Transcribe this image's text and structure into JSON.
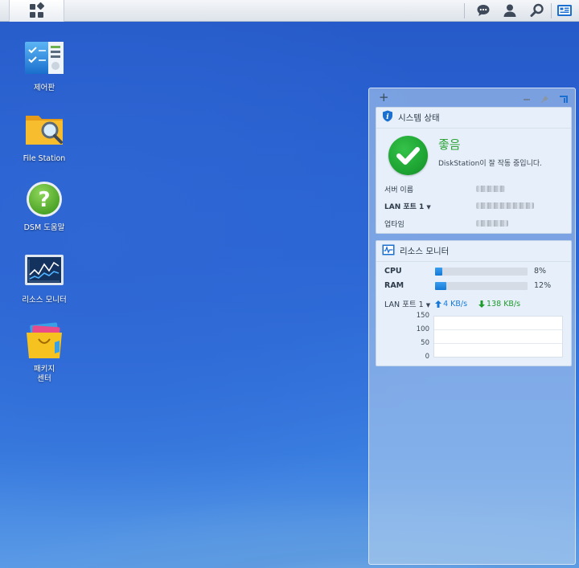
{
  "taskbar": {
    "main_menu_icon": "main-menu-grid-icon",
    "right_icons": [
      "chat-icon",
      "user-icon",
      "search-icon",
      "widgets-icon"
    ]
  },
  "desktop": {
    "icons": [
      {
        "label": "제어판",
        "icon": "control-panel-icon"
      },
      {
        "label": "File Station",
        "icon": "folder-search-icon"
      },
      {
        "label": "DSM 도움말",
        "icon": "help-icon"
      },
      {
        "label": "리소스 모니터",
        "icon": "resource-monitor-icon"
      },
      {
        "label": "패키지\n센터",
        "icon": "package-center-icon"
      }
    ]
  },
  "widgets": {
    "add_symbol": "+",
    "system_status": {
      "title": "시스템 상태",
      "status": "좋음",
      "description": "DiskStation이 잘 작동 중입니다.",
      "server_name_label": "서버 이름",
      "lan_label": "LAN 포트 1",
      "uptime_label": "업타임"
    },
    "resource_monitor": {
      "title": "리소스 모니터",
      "cpu_label": "CPU",
      "cpu_value": "8%",
      "cpu_fraction": 0.08,
      "ram_label": "RAM",
      "ram_value": "12%",
      "ram_fraction": 0.12,
      "lan_label": "LAN 포트 1",
      "upload": "4 KB/s",
      "download": "138 KB/s",
      "chart_ticks": [
        "150",
        "100",
        "50",
        "0"
      ]
    }
  },
  "colors": {
    "good_green": "#2ea336",
    "upload_blue": "#1679d8",
    "download_green": "#1f9a2c",
    "bar_blue": "#1479d6"
  }
}
